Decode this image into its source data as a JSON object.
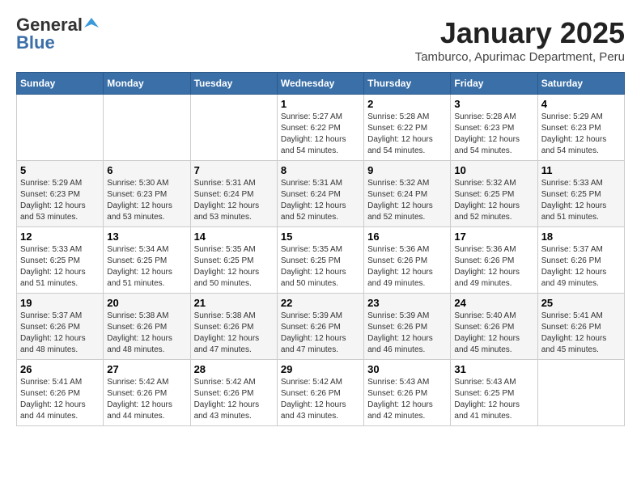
{
  "header": {
    "logo_general": "General",
    "logo_blue": "Blue",
    "month_title": "January 2025",
    "subtitle": "Tamburco, Apurimac Department, Peru"
  },
  "columns": [
    "Sunday",
    "Monday",
    "Tuesday",
    "Wednesday",
    "Thursday",
    "Friday",
    "Saturday"
  ],
  "weeks": [
    [
      {
        "day": "",
        "info": ""
      },
      {
        "day": "",
        "info": ""
      },
      {
        "day": "",
        "info": ""
      },
      {
        "day": "1",
        "info": "Sunrise: 5:27 AM\nSunset: 6:22 PM\nDaylight: 12 hours\nand 54 minutes."
      },
      {
        "day": "2",
        "info": "Sunrise: 5:28 AM\nSunset: 6:22 PM\nDaylight: 12 hours\nand 54 minutes."
      },
      {
        "day": "3",
        "info": "Sunrise: 5:28 AM\nSunset: 6:23 PM\nDaylight: 12 hours\nand 54 minutes."
      },
      {
        "day": "4",
        "info": "Sunrise: 5:29 AM\nSunset: 6:23 PM\nDaylight: 12 hours\nand 54 minutes."
      }
    ],
    [
      {
        "day": "5",
        "info": "Sunrise: 5:29 AM\nSunset: 6:23 PM\nDaylight: 12 hours\nand 53 minutes."
      },
      {
        "day": "6",
        "info": "Sunrise: 5:30 AM\nSunset: 6:23 PM\nDaylight: 12 hours\nand 53 minutes."
      },
      {
        "day": "7",
        "info": "Sunrise: 5:31 AM\nSunset: 6:24 PM\nDaylight: 12 hours\nand 53 minutes."
      },
      {
        "day": "8",
        "info": "Sunrise: 5:31 AM\nSunset: 6:24 PM\nDaylight: 12 hours\nand 52 minutes."
      },
      {
        "day": "9",
        "info": "Sunrise: 5:32 AM\nSunset: 6:24 PM\nDaylight: 12 hours\nand 52 minutes."
      },
      {
        "day": "10",
        "info": "Sunrise: 5:32 AM\nSunset: 6:25 PM\nDaylight: 12 hours\nand 52 minutes."
      },
      {
        "day": "11",
        "info": "Sunrise: 5:33 AM\nSunset: 6:25 PM\nDaylight: 12 hours\nand 51 minutes."
      }
    ],
    [
      {
        "day": "12",
        "info": "Sunrise: 5:33 AM\nSunset: 6:25 PM\nDaylight: 12 hours\nand 51 minutes."
      },
      {
        "day": "13",
        "info": "Sunrise: 5:34 AM\nSunset: 6:25 PM\nDaylight: 12 hours\nand 51 minutes."
      },
      {
        "day": "14",
        "info": "Sunrise: 5:35 AM\nSunset: 6:25 PM\nDaylight: 12 hours\nand 50 minutes."
      },
      {
        "day": "15",
        "info": "Sunrise: 5:35 AM\nSunset: 6:25 PM\nDaylight: 12 hours\nand 50 minutes."
      },
      {
        "day": "16",
        "info": "Sunrise: 5:36 AM\nSunset: 6:26 PM\nDaylight: 12 hours\nand 49 minutes."
      },
      {
        "day": "17",
        "info": "Sunrise: 5:36 AM\nSunset: 6:26 PM\nDaylight: 12 hours\nand 49 minutes."
      },
      {
        "day": "18",
        "info": "Sunrise: 5:37 AM\nSunset: 6:26 PM\nDaylight: 12 hours\nand 49 minutes."
      }
    ],
    [
      {
        "day": "19",
        "info": "Sunrise: 5:37 AM\nSunset: 6:26 PM\nDaylight: 12 hours\nand 48 minutes."
      },
      {
        "day": "20",
        "info": "Sunrise: 5:38 AM\nSunset: 6:26 PM\nDaylight: 12 hours\nand 48 minutes."
      },
      {
        "day": "21",
        "info": "Sunrise: 5:38 AM\nSunset: 6:26 PM\nDaylight: 12 hours\nand 47 minutes."
      },
      {
        "day": "22",
        "info": "Sunrise: 5:39 AM\nSunset: 6:26 PM\nDaylight: 12 hours\nand 47 minutes."
      },
      {
        "day": "23",
        "info": "Sunrise: 5:39 AM\nSunset: 6:26 PM\nDaylight: 12 hours\nand 46 minutes."
      },
      {
        "day": "24",
        "info": "Sunrise: 5:40 AM\nSunset: 6:26 PM\nDaylight: 12 hours\nand 45 minutes."
      },
      {
        "day": "25",
        "info": "Sunrise: 5:41 AM\nSunset: 6:26 PM\nDaylight: 12 hours\nand 45 minutes."
      }
    ],
    [
      {
        "day": "26",
        "info": "Sunrise: 5:41 AM\nSunset: 6:26 PM\nDaylight: 12 hours\nand 44 minutes."
      },
      {
        "day": "27",
        "info": "Sunrise: 5:42 AM\nSunset: 6:26 PM\nDaylight: 12 hours\nand 44 minutes."
      },
      {
        "day": "28",
        "info": "Sunrise: 5:42 AM\nSunset: 6:26 PM\nDaylight: 12 hours\nand 43 minutes."
      },
      {
        "day": "29",
        "info": "Sunrise: 5:42 AM\nSunset: 6:26 PM\nDaylight: 12 hours\nand 43 minutes."
      },
      {
        "day": "30",
        "info": "Sunrise: 5:43 AM\nSunset: 6:26 PM\nDaylight: 12 hours\nand 42 minutes."
      },
      {
        "day": "31",
        "info": "Sunrise: 5:43 AM\nSunset: 6:25 PM\nDaylight: 12 hours\nand 41 minutes."
      },
      {
        "day": "",
        "info": ""
      }
    ]
  ]
}
